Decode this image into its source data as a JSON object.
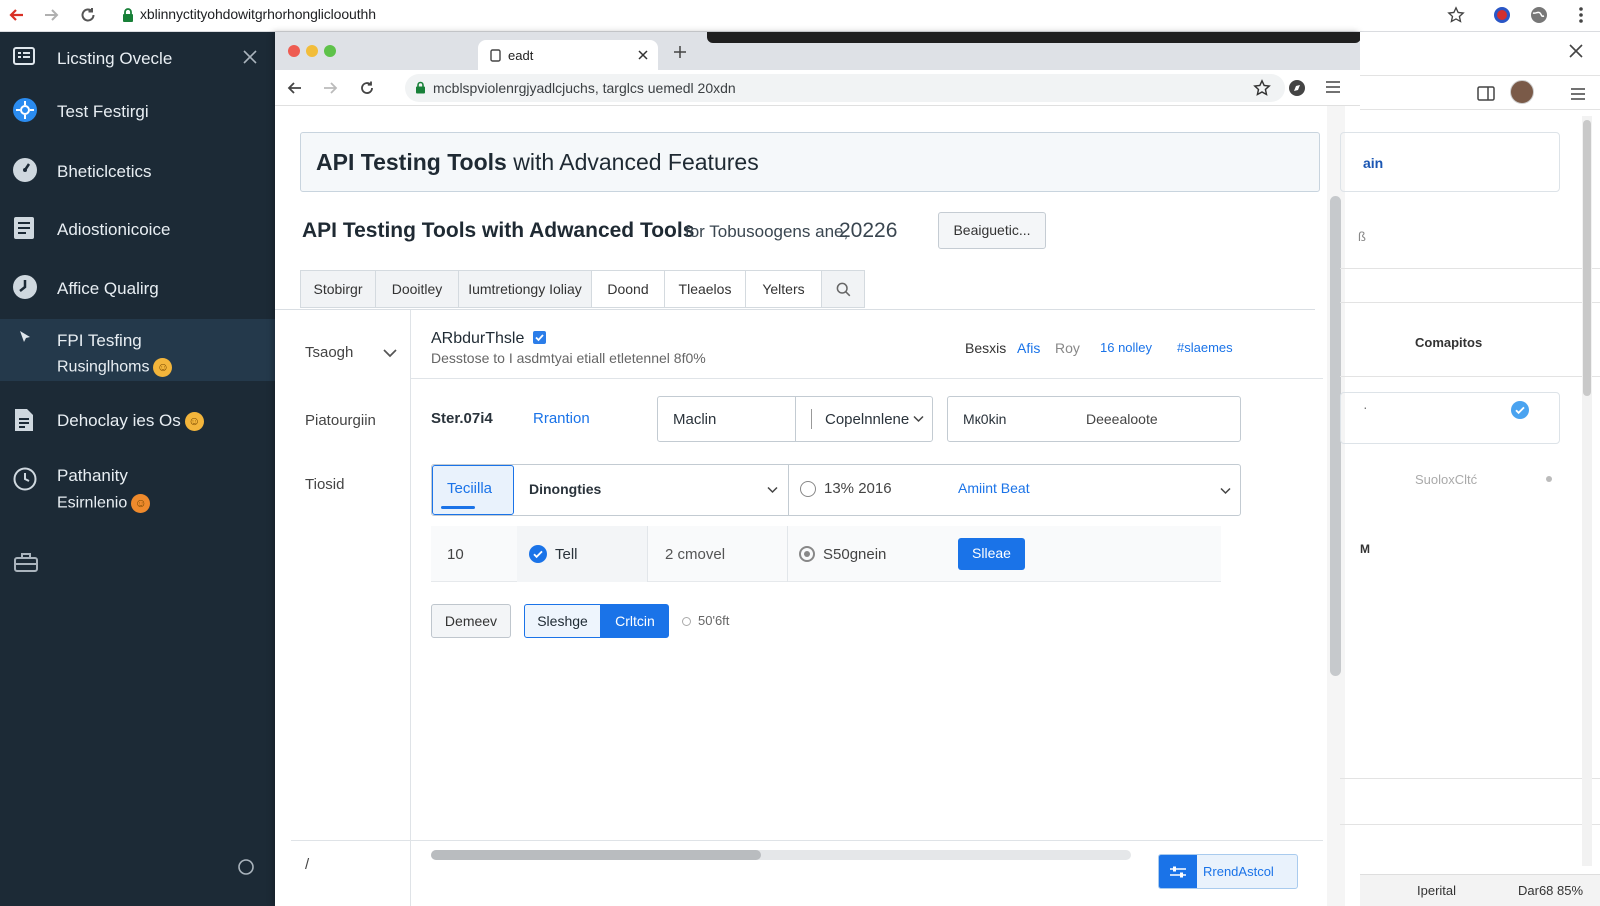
{
  "outer": {
    "url": "xblinnyctityohdowitgrhorhonglicloouthh"
  },
  "sidebar": {
    "items": [
      {
        "label": "Licsting Ovecle"
      },
      {
        "label": "Test Festirgi"
      },
      {
        "label": "Bheticlcetics"
      },
      {
        "label": "Adiostionicoice"
      },
      {
        "label": "Affice Qualirg"
      },
      {
        "label": "FPI Tesfing",
        "sub": "Rusinglhoms"
      },
      {
        "label": "Dehoclay ies Os"
      },
      {
        "label": "Pathanity",
        "sub": "Esirnlenio"
      }
    ]
  },
  "inner": {
    "tab_title": "eadt",
    "url": "mcblspviolenrgjyadlcjuchs, targlcs uemedl 20xdn"
  },
  "page": {
    "title_bold": "API Testing Tools",
    "title_rest": " with Advanced Features",
    "subtitle": "API Testing Tools with Adwanced Tools",
    "subtitle_small": "for Tobusoogens ane,",
    "subtitle_year": "20226",
    "header_button": "Beaiguetic...",
    "tabs": [
      "Stobirgr",
      "Dooitley",
      "Iumtretiongy Ioliay",
      "Doond",
      "Tleaelos",
      "Yelters"
    ],
    "left_labels": [
      "Tsaogh",
      "Piatourgiin",
      "Tiosid"
    ],
    "left_footer": "/",
    "card": {
      "name": "ARbdurThsle",
      "desc": "Desstose to I asdmtyai etiall etletennel 8f0%",
      "links": [
        "Besxis",
        "Afis",
        "Roy",
        "16 nolley",
        "#slaemes"
      ]
    },
    "row1": {
      "label": "Ster.07i4",
      "link": "Rrantion",
      "f1": "Maclin",
      "f2": "Copelnnlene",
      "f3": "Mк0kin",
      "f4": "Deeealoote"
    },
    "row2": {
      "tab": "Teciilla",
      "select": "Dinongties",
      "radio": "13%  2016",
      "link": "Amiint Beat"
    },
    "row3": {
      "num": "10",
      "check": "Tell",
      "moves": "2  cmovel",
      "radio": "S50gnein",
      "button": "Slleae"
    },
    "row4": {
      "b1": "Demeev",
      "b2": "Sleshge",
      "b3": "Crltcin",
      "pct": "50'6ft"
    },
    "action_button": "RrendAstcol"
  },
  "right": {
    "partial1": "ain",
    "partial2": "ß",
    "heading": "Comapitos",
    "partial3": "·",
    "faded": "SuoloxCltć",
    "partial4": "M",
    "status_left": "Iperital",
    "status_right": "Dar68 85%"
  },
  "colors": {
    "accent": "#1a73e8",
    "sidebar_bg": "#1c2a36",
    "sidebar_active": "#24394b"
  }
}
